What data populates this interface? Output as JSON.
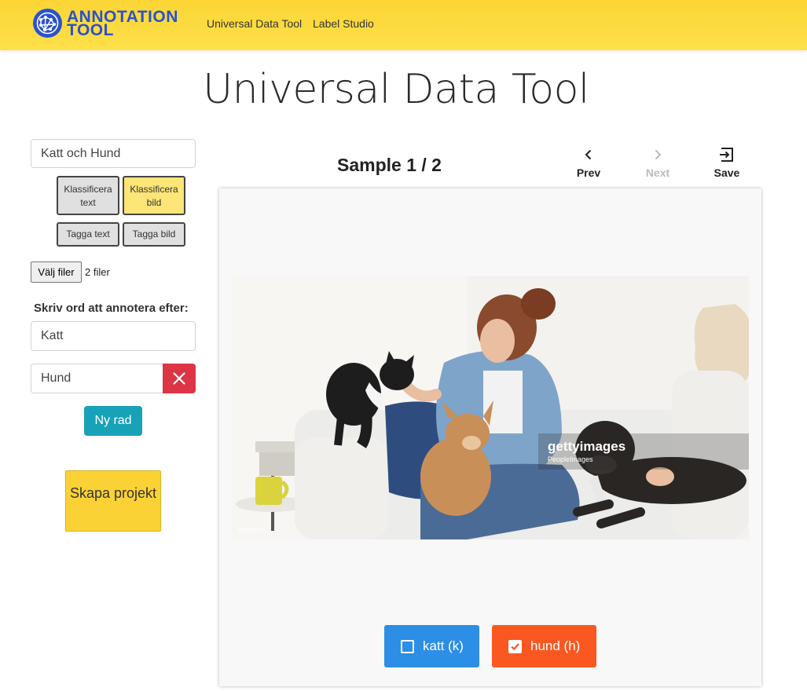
{
  "navbar": {
    "brand_line1": "ANNOTATION",
    "brand_line2": "TOOL",
    "links": [
      "Universal Data Tool",
      "Label Studio"
    ],
    "brand_color": "#2a52cc",
    "background": "#fcd535"
  },
  "page": {
    "title": "Universal Data Tool"
  },
  "sidebar": {
    "project_name": "Katt och Hund",
    "type_buttons": [
      {
        "label": "Klassificera text",
        "active": false
      },
      {
        "label": "Klassificera bild",
        "active": true
      },
      {
        "label": "Tagga text",
        "active": false
      },
      {
        "label": "Tagga bild",
        "active": false
      }
    ],
    "file_button": "Välj filer",
    "file_status": "2 filer",
    "labels_heading": "Skriv ord att annotera efter:",
    "labels": [
      "Katt",
      "Hund"
    ],
    "delete_icon": "close-icon",
    "new_row_button": "Ny rad",
    "create_button": "Skapa projekt"
  },
  "main": {
    "sample_title": "Sample 1 / 2",
    "actions": [
      {
        "label": "Prev",
        "icon": "chevron-left-icon",
        "enabled": true
      },
      {
        "label": "Next",
        "icon": "chevron-right-icon",
        "enabled": false
      },
      {
        "label": "Save",
        "icon": "exit-icon",
        "enabled": true
      }
    ],
    "image_watermark": "gettyimages",
    "image_credit": "PeopleImages",
    "image_id": "499806311",
    "choices": [
      {
        "label": "katt (k)",
        "checked": false,
        "color": "#2c8ee5"
      },
      {
        "label": "hund (h)",
        "checked": true,
        "color": "#fb5721"
      }
    ]
  }
}
